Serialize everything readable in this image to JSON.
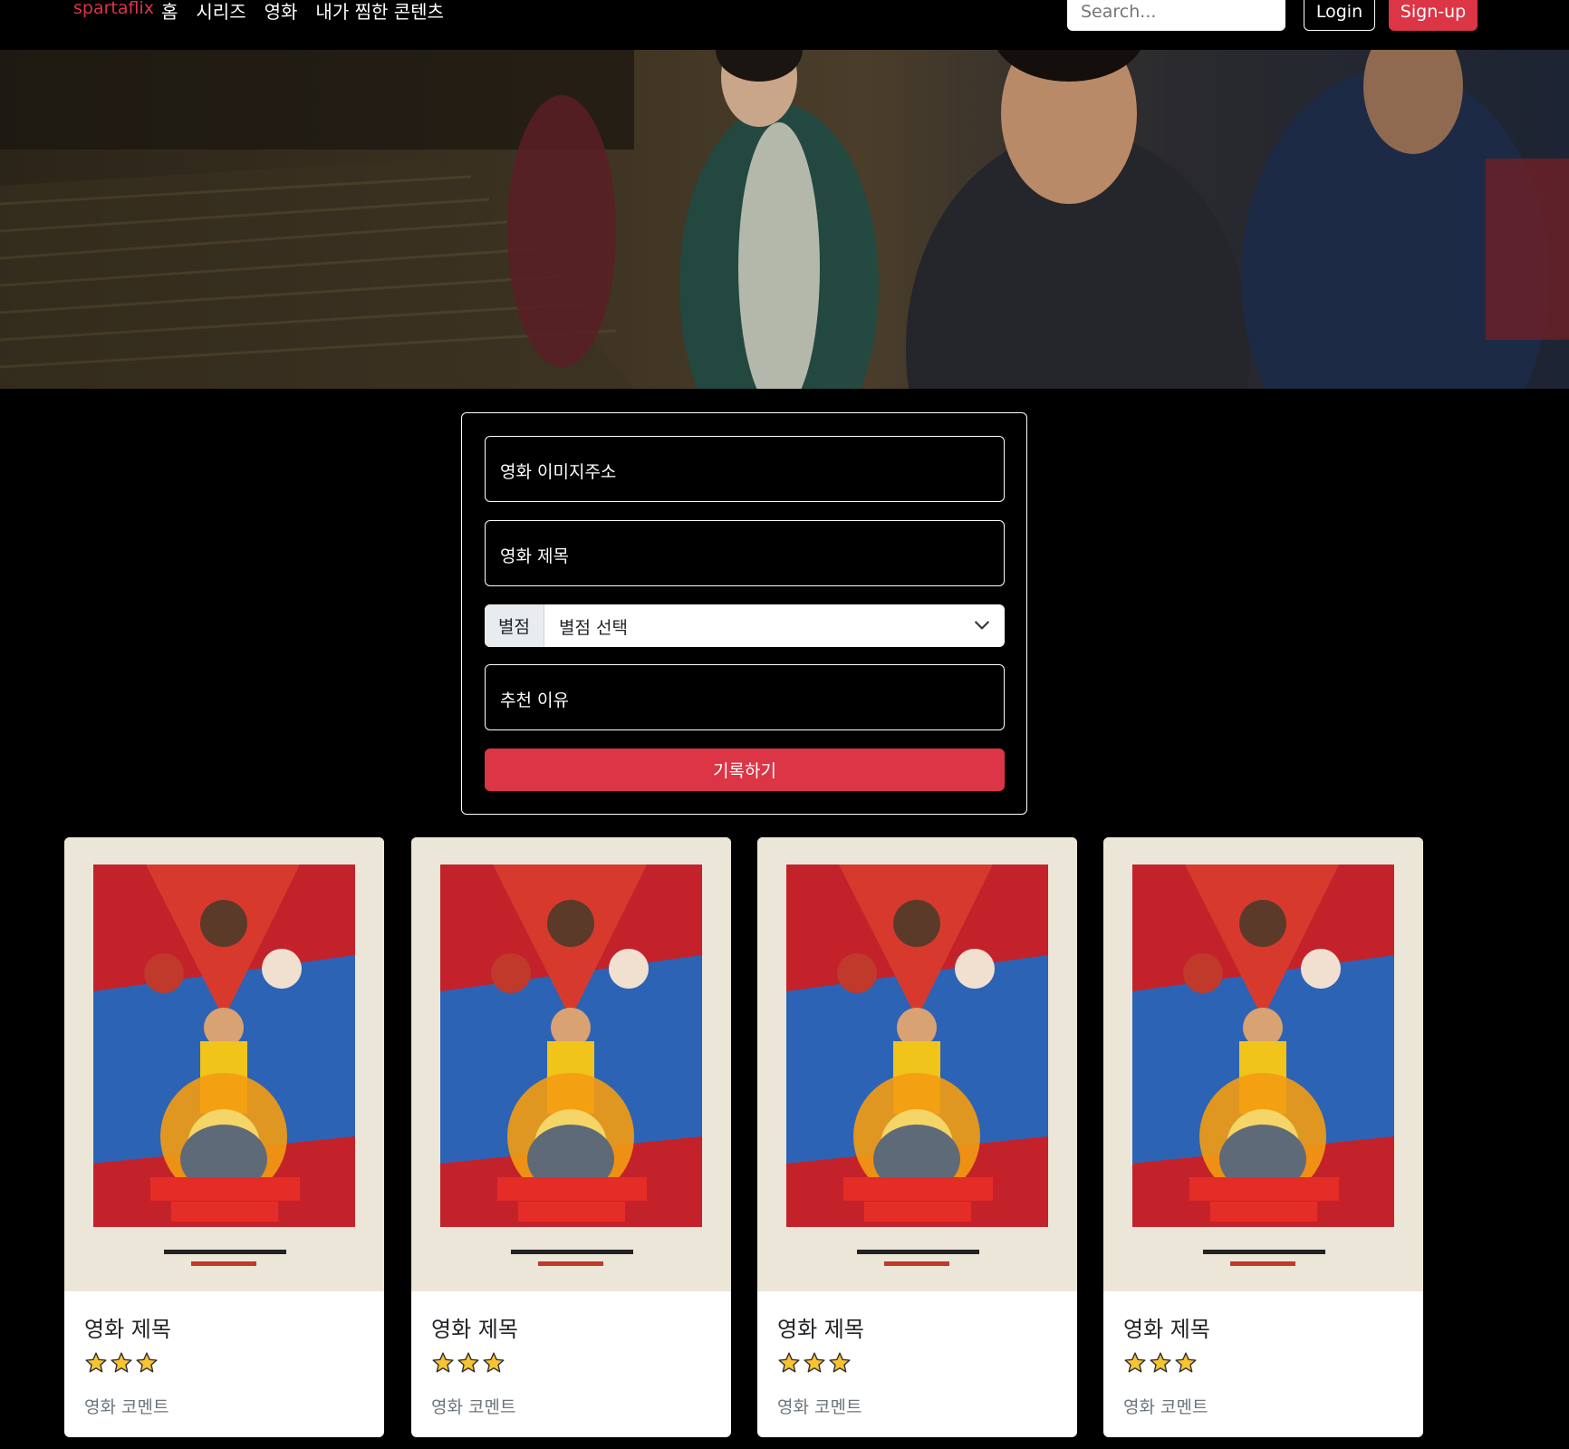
{
  "nav": {
    "brand": "spartaflix",
    "links": [
      "홈",
      "시리즈",
      "영화",
      "내가 찜한 콘텐츠"
    ],
    "search_placeholder": "Search...",
    "login_label": "Login",
    "signup_label": "Sign-up"
  },
  "form": {
    "image_url_label": "영화 이미지주소",
    "title_label": "영화 제목",
    "rating_prefix": "별점",
    "rating_selected": "별점 선택",
    "reason_label": "추천 이유",
    "submit_label": "기록하기"
  },
  "cards": [
    {
      "title": "영화 제목",
      "stars": 3,
      "comment": "영화 코멘트"
    },
    {
      "title": "영화 제목",
      "stars": 3,
      "comment": "영화 코멘트"
    },
    {
      "title": "영화 제목",
      "stars": 3,
      "comment": "영화 코멘트"
    },
    {
      "title": "영화 제목",
      "stars": 3,
      "comment": "영화 코멘트"
    }
  ],
  "colors": {
    "accent": "#dc3545",
    "background": "#000000"
  }
}
